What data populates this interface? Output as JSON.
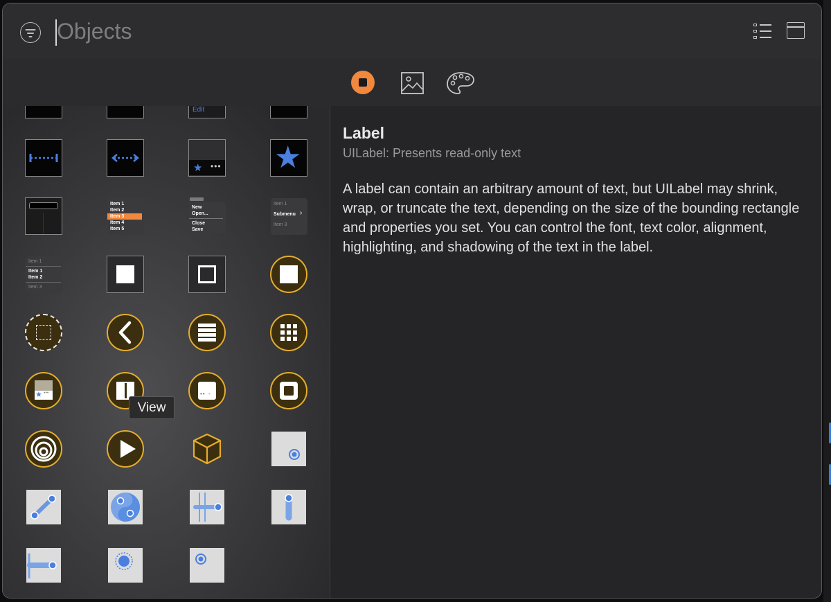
{
  "search": {
    "placeholder": "Objects",
    "value": ""
  },
  "toolbar": {
    "tabs": [
      {
        "icon": "objects-icon",
        "active": true
      },
      {
        "icon": "media-icon",
        "active": false
      },
      {
        "icon": "color-palette-icon",
        "active": false
      }
    ]
  },
  "library": {
    "items": [
      "page-control",
      "stepper",
      "progress-view",
      "slider",
      "search-bar",
      "table-view",
      "collection-view",
      "tab-bar",
      "menu-list",
      "submenu-list",
      "view",
      "container-view",
      "dashed-view-controller",
      "navigation-controller",
      "table-view-controller",
      "collection-view-controller",
      "tab-bar-controller",
      "split-view-controller",
      "page-view-controller",
      "hosting-controller",
      "storyboard-reference",
      "player-view-controller",
      "object",
      "tap-gesture-recognizer",
      "pinch-gesture-recognizer",
      "rotation-gesture-recognizer",
      "swipe-gesture-recognizer",
      "pan-gesture-recognizer",
      "screen-edge-pan-gesture-recognizer",
      "long-press-gesture-recognizer",
      "hover-gesture-recognizer"
    ],
    "edit_label": "Edit",
    "table_items": [
      "Item 1",
      "Item 2",
      "Item 3",
      "Item 4",
      "Item 5"
    ],
    "menu_items": [
      "New",
      "Open...",
      "Close",
      "Save"
    ],
    "submenu_items": [
      "Item 1",
      "Submenu",
      "Item 3"
    ],
    "list_items": [
      "Item 1",
      "Item 1",
      "Item 2",
      "Item 3"
    ]
  },
  "tooltip": {
    "text": "View"
  },
  "detail": {
    "title": "Label",
    "subtitle": "UILabel: Presents read-only text",
    "description": "A label can contain an arbitrary amount of text, but UILabel may shrink, wrap, or truncate the text, depending on the size of the bounding rectangle and properties you set. You can control the font, text color, alignment, highlighting, and shadowing of the text in the label."
  },
  "colors": {
    "accent": "#f0883e",
    "controller_gold": "#e4ad2f",
    "system_blue": "#4a7fe0"
  }
}
